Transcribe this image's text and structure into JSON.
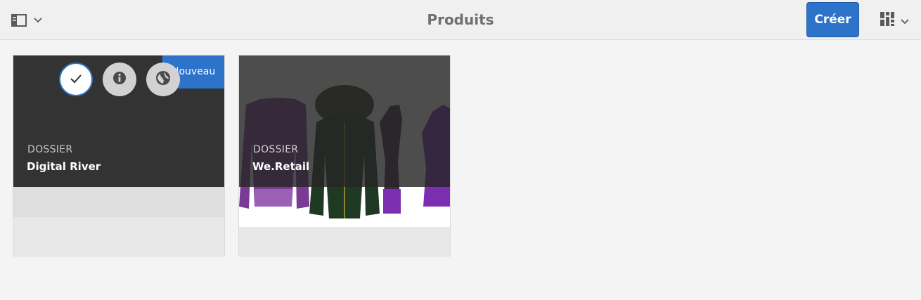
{
  "header": {
    "title": "Produits",
    "create_label": "Créer",
    "rail_icon": "sidebar-toggle-icon",
    "view_icon": "card-view-icon"
  },
  "cards": [
    {
      "kind": "DOSSIER",
      "title": "Digital River",
      "badge": "Nouveau",
      "selected": false,
      "quick_actions": [
        "check-icon",
        "info-icon",
        "publish-globe-icon"
      ]
    },
    {
      "kind": "DOSSIER",
      "title": "We.Retail",
      "thumbnail": "apparel-thumbnail"
    }
  ],
  "colors": {
    "accent": "#2d73c9",
    "header_bg": "#f0f0f0",
    "page_bg": "#f4f4f4",
    "card_dark": "#333333",
    "title_gray": "#707070"
  }
}
